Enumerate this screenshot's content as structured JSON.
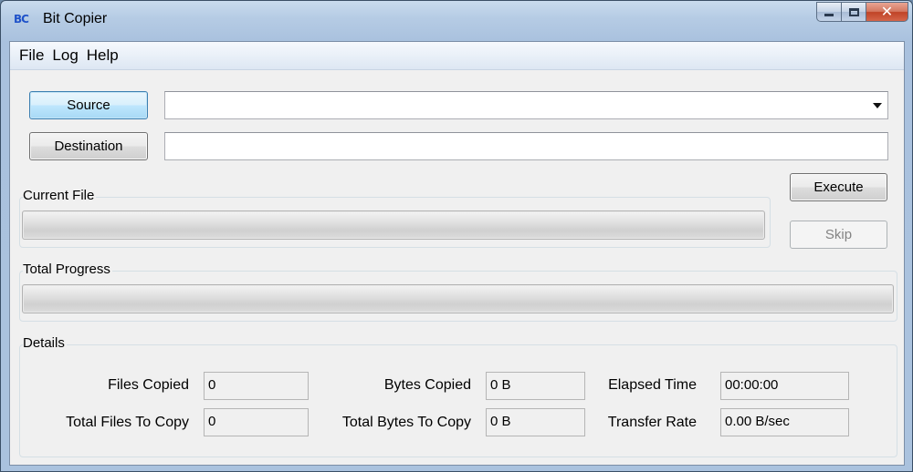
{
  "window": {
    "logo_text": "BC",
    "title": "Bit Copier",
    "close_glyph": "✕"
  },
  "menu": [
    "File",
    "Log",
    "Help"
  ],
  "source": {
    "button_label": "Source",
    "value": ""
  },
  "destination": {
    "button_label": "Destination",
    "value": ""
  },
  "actions": {
    "execute_label": "Execute",
    "skip_label": "Skip"
  },
  "current_file": {
    "group_label": "Current File",
    "progress": 0
  },
  "total_progress": {
    "group_label": "Total Progress",
    "progress": 0
  },
  "details": {
    "group_label": "Details",
    "files_copied_label": "Files Copied",
    "files_copied": "0",
    "total_files_label": "Total Files To Copy",
    "total_files": "0",
    "bytes_copied_label": "Bytes Copied",
    "bytes_copied": "0 B",
    "total_bytes_label": "Total Bytes To Copy",
    "total_bytes": "0 B",
    "elapsed_label": "Elapsed Time",
    "elapsed": "00:00:00",
    "rate_label": "Transfer Rate",
    "rate": "0.00 B/sec"
  }
}
